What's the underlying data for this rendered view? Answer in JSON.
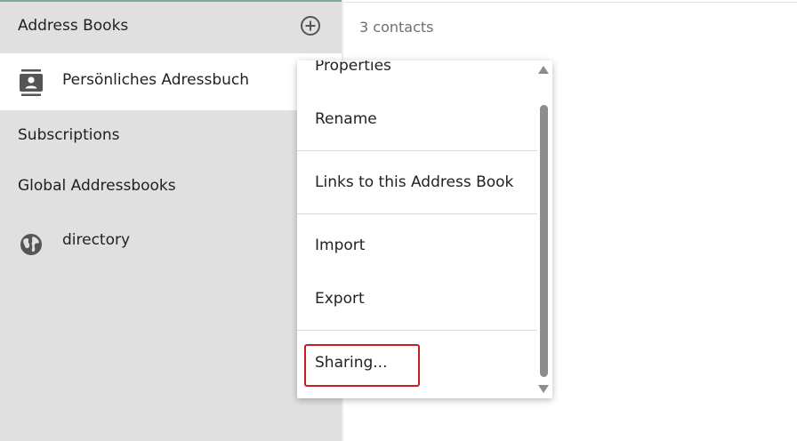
{
  "sidebar": {
    "address_books_header": "Address Books",
    "address_books": [
      {
        "label": "Persönliches Adressbuch",
        "icon": "contact-card-icon",
        "selected": true
      }
    ],
    "subscriptions_header": "Subscriptions",
    "global_header": "Global Addressbooks",
    "global_items": [
      {
        "label": "directory",
        "icon": "globe-icon"
      }
    ]
  },
  "main": {
    "contacts_count": "3 contacts"
  },
  "context_menu": {
    "items": [
      {
        "label": "Properties"
      },
      {
        "label": "Rename"
      },
      {
        "label": "Links to this Address Book"
      },
      {
        "label": "Import"
      },
      {
        "label": "Export"
      },
      {
        "label": "Sharing..."
      }
    ]
  },
  "colors": {
    "sidebar_bg": "#e0e0e0",
    "selected_bg": "#ffffff",
    "accent_line": "#7fa9a0",
    "highlight": "#c81d25"
  }
}
